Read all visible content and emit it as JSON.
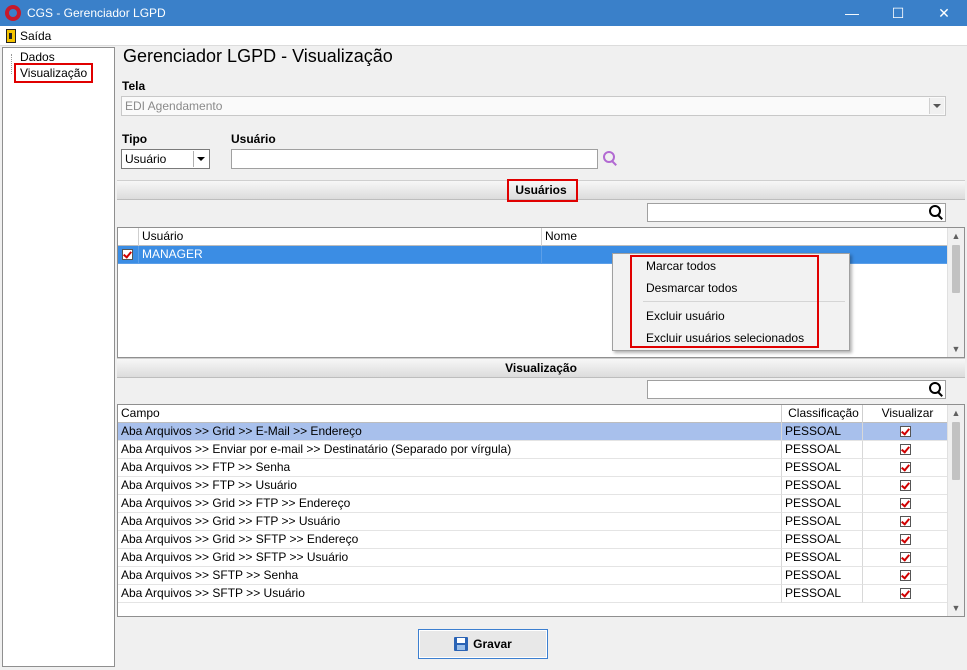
{
  "window": {
    "title": "CGS - Gerenciador LGPD",
    "minimize": "—",
    "maximize": "☐",
    "close": "✕"
  },
  "menubar": {
    "exit_label": "Saída"
  },
  "tree": {
    "items": [
      {
        "label": "Dados"
      },
      {
        "label": "Visualização"
      }
    ],
    "selected_index": 1
  },
  "header": {
    "title": "Gerenciador LGPD - Visualização"
  },
  "tela": {
    "label": "Tela",
    "value": "EDI Agendamento"
  },
  "tipo": {
    "label": "Tipo",
    "value": "Usuário"
  },
  "usuario_filter": {
    "label": "Usuário",
    "value": ""
  },
  "usuarios_section": {
    "title": "Usuários",
    "search_value": "",
    "columns": [
      "Usuário",
      "Nome"
    ],
    "rows": [
      {
        "checked": true,
        "usuario": "MANAGER",
        "nome": ""
      }
    ]
  },
  "context_menu": {
    "items": [
      "Marcar todos",
      "Desmarcar todos",
      "Excluir usuário",
      "Excluir usuários selecionados"
    ]
  },
  "visualizacao_section": {
    "title": "Visualização",
    "search_value": "",
    "columns": [
      "Campo",
      "Classificação",
      "Visualizar"
    ],
    "rows": [
      {
        "campo": "Aba Arquivos  >> Grid >> E-Mail >> Endereço",
        "classificacao": "PESSOAL",
        "visualizar": true
      },
      {
        "campo": "Aba Arquivos >> Enviar por e-mail >> Destinatário (Separado por vírgula)",
        "classificacao": "PESSOAL",
        "visualizar": true
      },
      {
        "campo": "Aba Arquivos >> FTP >> Senha",
        "classificacao": "PESSOAL",
        "visualizar": true
      },
      {
        "campo": "Aba Arquivos >> FTP >> Usuário",
        "classificacao": "PESSOAL",
        "visualizar": true
      },
      {
        "campo": "Aba Arquivos >> Grid >> FTP >>  Endereço",
        "classificacao": "PESSOAL",
        "visualizar": true
      },
      {
        "campo": "Aba Arquivos >> Grid >> FTP >> Usuário",
        "classificacao": "PESSOAL",
        "visualizar": true
      },
      {
        "campo": "Aba Arquivos >> Grid >> SFTP >> Endereço",
        "classificacao": "PESSOAL",
        "visualizar": true
      },
      {
        "campo": "Aba Arquivos >> Grid >> SFTP >> Usuário",
        "classificacao": "PESSOAL",
        "visualizar": true
      },
      {
        "campo": "Aba Arquivos >> SFTP >> Senha",
        "classificacao": "PESSOAL",
        "visualizar": true
      },
      {
        "campo": "Aba Arquivos >> SFTP >> Usuário",
        "classificacao": "PESSOAL",
        "visualizar": true
      }
    ]
  },
  "footer": {
    "save_label": "Gravar"
  },
  "colors": {
    "titlebar": "#3a80c9",
    "selection": "#3b8de4",
    "row_selected": "#a8c0ec",
    "highlight": "#e00000",
    "check": "#d00000"
  }
}
